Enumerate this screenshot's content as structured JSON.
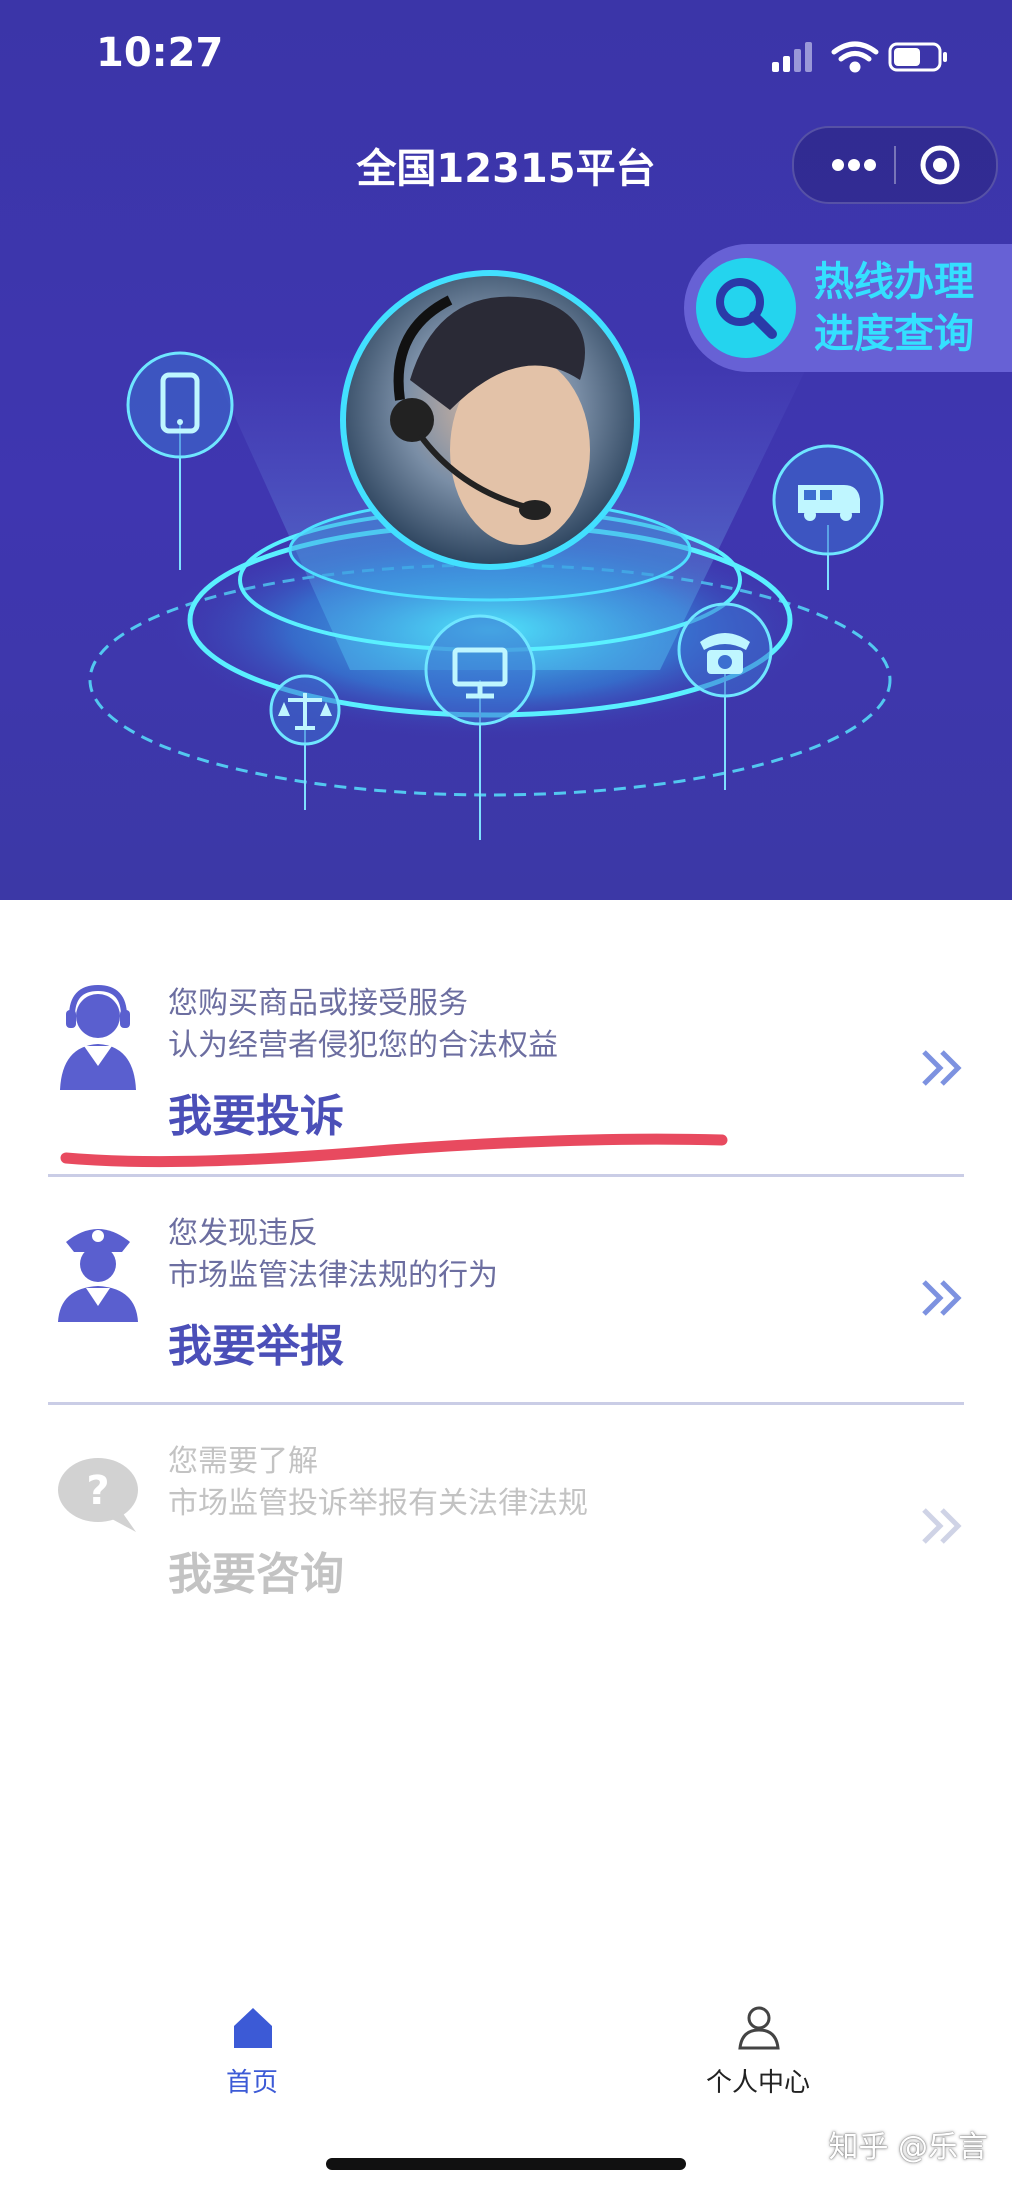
{
  "status": {
    "time": "10:27"
  },
  "nav": {
    "title": "全国12315平台"
  },
  "hotline": {
    "line1": "热线办理",
    "line2": "进度查询"
  },
  "entries": [
    {
      "line1": "您购买商品或接受服务",
      "line2": "认为经营者侵犯您的合法权益",
      "action": "我要投诉",
      "icon": "customer-service-agent-icon"
    },
    {
      "line1": "您发现违反",
      "line2": "市场监管法律法规的行为",
      "action": "我要举报",
      "icon": "police-officer-icon"
    },
    {
      "line1": "您需要了解",
      "line2": "市场监管投诉举报有关法律法规",
      "action": "我要咨询",
      "icon": "question-bubble-icon"
    }
  ],
  "tabs": [
    {
      "label": "首页",
      "icon": "home-icon",
      "active": true
    },
    {
      "label": "个人中心",
      "icon": "user-icon",
      "active": false
    }
  ],
  "watermark": "知乎 @乐言",
  "colors": {
    "hero_bg": "#3f36b0",
    "accent": "#4b4fb8",
    "cyan": "#34e0ff",
    "annotation": "#e84a5f"
  }
}
